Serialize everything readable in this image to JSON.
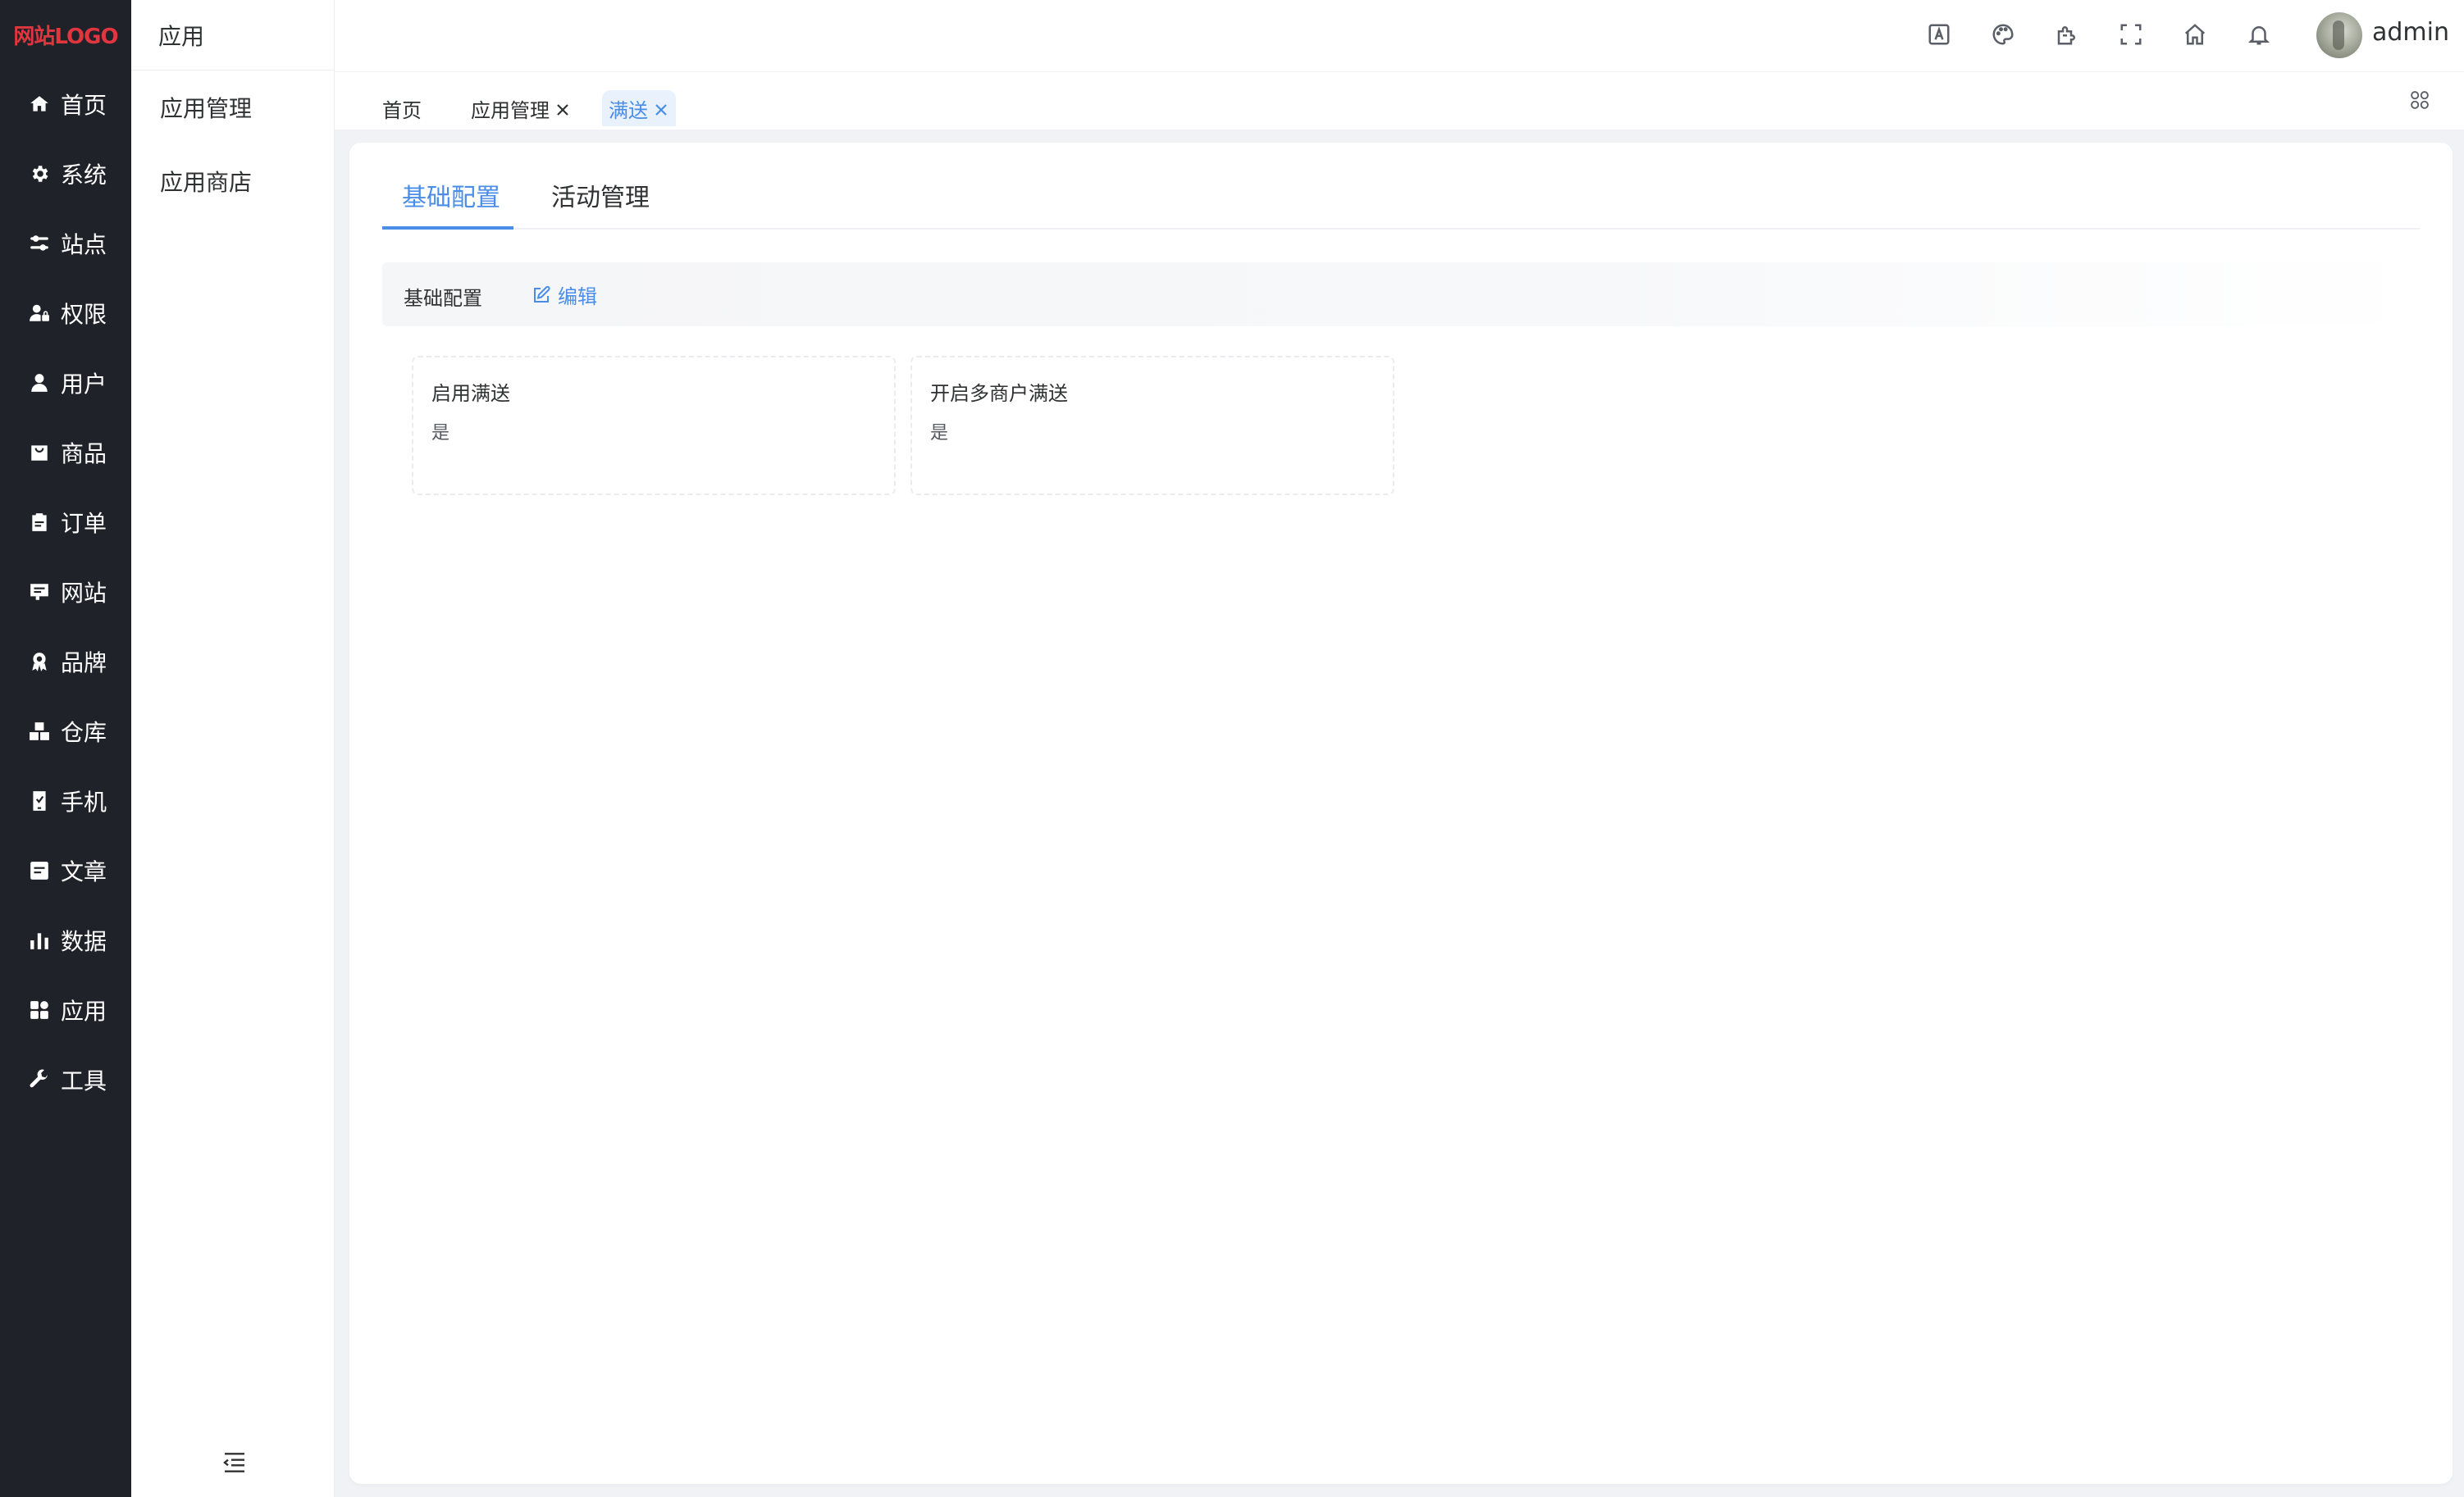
{
  "logo": {
    "text": "网站LOGO"
  },
  "sidemenu": {
    "items": [
      {
        "label": "首页",
        "icon": "home-icon"
      },
      {
        "label": "系统",
        "icon": "gear-icon"
      },
      {
        "label": "站点",
        "icon": "sliders-icon"
      },
      {
        "label": "权限",
        "icon": "user-lock-icon"
      },
      {
        "label": "用户",
        "icon": "user-icon"
      },
      {
        "label": "商品",
        "icon": "bag-icon"
      },
      {
        "label": "订单",
        "icon": "clipboard-icon"
      },
      {
        "label": "网站",
        "icon": "monitor-icon"
      },
      {
        "label": "品牌",
        "icon": "badge-icon"
      },
      {
        "label": "仓库",
        "icon": "boxes-icon"
      },
      {
        "label": "手机",
        "icon": "phone-icon"
      },
      {
        "label": "文章",
        "icon": "document-icon"
      },
      {
        "label": "数据",
        "icon": "bar-chart-icon"
      },
      {
        "label": "应用",
        "icon": "apps-icon"
      },
      {
        "label": "工具",
        "icon": "wrench-icon"
      }
    ]
  },
  "submenu": {
    "title": "应用",
    "items": [
      {
        "label": "应用管理"
      },
      {
        "label": "应用商店"
      }
    ]
  },
  "header": {
    "icons": [
      "translate-icon",
      "palette-icon",
      "puzzle-icon",
      "fullscreen-icon",
      "home-icon",
      "bell-icon"
    ],
    "username": "admin"
  },
  "tags": [
    {
      "label": "首页",
      "closable": false,
      "active": false
    },
    {
      "label": "应用管理",
      "closable": true,
      "active": false
    },
    {
      "label": "满送",
      "closable": true,
      "active": true
    }
  ],
  "main": {
    "tabs": [
      {
        "label": "基础配置",
        "active": true
      },
      {
        "label": "活动管理",
        "active": false
      }
    ],
    "section": {
      "title": "基础配置",
      "edit_label": "编辑"
    },
    "fields": [
      {
        "label": "启用满送",
        "value": "是"
      },
      {
        "label": "开启多商户满送",
        "value": "是"
      }
    ]
  },
  "colors": {
    "accent": "#4a8de6",
    "sidebar_bg": "#1f2229",
    "logo": "#e0363f"
  }
}
